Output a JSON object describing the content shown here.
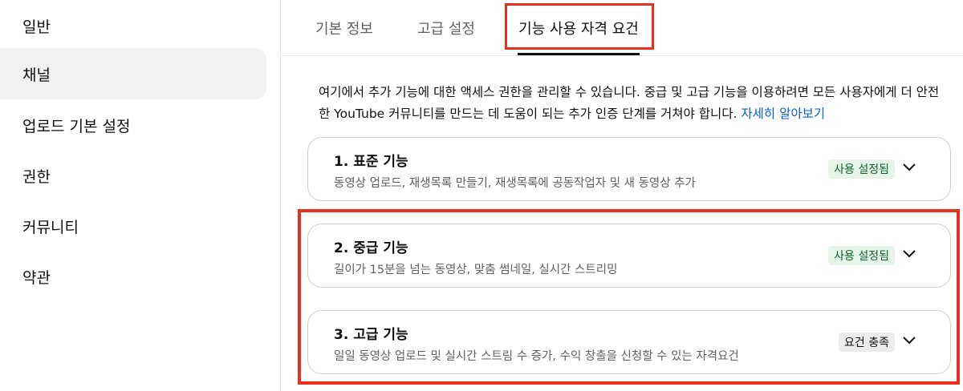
{
  "sidebar": {
    "items": [
      {
        "label": "일반"
      },
      {
        "label": "채널"
      },
      {
        "label": "업로드 기본 설정"
      },
      {
        "label": "권한"
      },
      {
        "label": "커뮤니티"
      },
      {
        "label": "약관"
      }
    ]
  },
  "tabs": [
    {
      "label": "기본 정보"
    },
    {
      "label": "고급 설정"
    },
    {
      "label": "기능 사용 자격 요건"
    }
  ],
  "description": {
    "text": "여기에서 추가 기능에 대한 액세스 권한을 관리할 수 있습니다. 중급 및 고급 기능을 이용하려면 모든 사용자에게 더 안전한 YouTube 커뮤니티를 만드는 데 도움이 되는 추가 인증 단계를 거쳐야 합니다.",
    "link": "자세히 알아보기"
  },
  "features": [
    {
      "title": "1. 표준 기능",
      "subtitle": "동영상 업로드, 재생목록 만들기, 재생목록에 공동작업자 및 새 동영상 추가",
      "status": "사용 설정됨"
    },
    {
      "title": "2. 중급 기능",
      "subtitle": "길이가 15분을 넘는 동영상, 맞춤 썸네일, 실시간 스트리밍",
      "status": "사용 설정됨"
    },
    {
      "title": "3. 고급 기능",
      "subtitle": "일일 동영상 업로드 및 실시간 스트림 수 증가, 수익 창출을 신청할 수 있는 자격요건",
      "status": "요건 충족"
    }
  ],
  "colors": {
    "accent_highlight": "#e8301c",
    "link": "#065fd4",
    "status_enabled_bg": "#e6f4ea",
    "status_enabled_text": "#0d652d",
    "status_met_bg": "#ececec"
  }
}
